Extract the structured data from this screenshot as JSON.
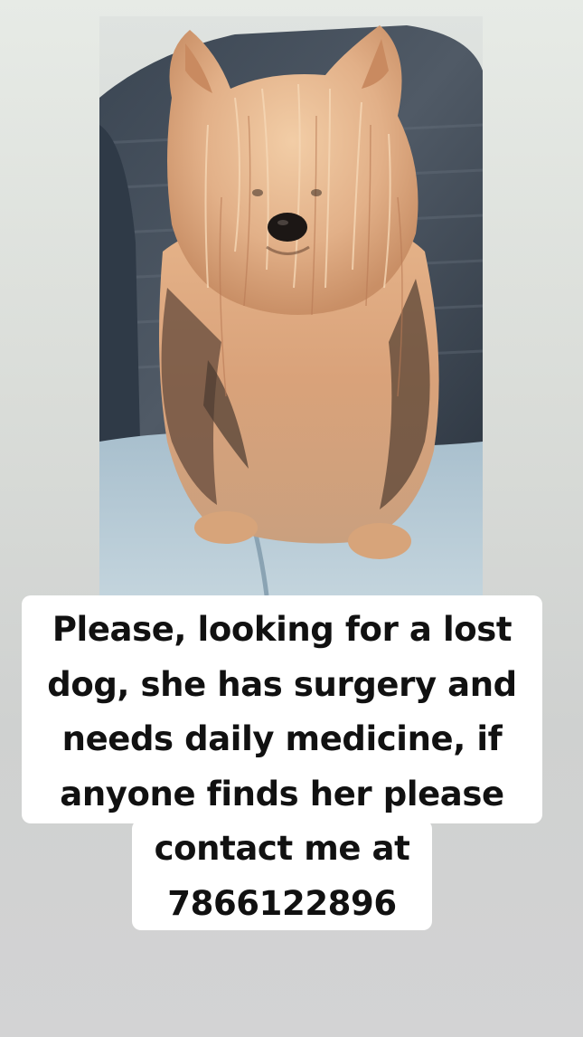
{
  "story": {
    "caption_lines": [
      "Please, looking for a lost",
      "dog, she has surgery and",
      "needs daily medicine, if",
      "anyone finds her please",
      "contact me at",
      "7866122896"
    ]
  },
  "colors": {
    "caption_background": "#ffffff",
    "caption_text": "#111111",
    "dog_fur_light": "#e8b98f",
    "dog_fur_dark": "#5a4436",
    "jeans": "#b9cdd8"
  },
  "icons": {
    "photo": "lost-dog-photo"
  }
}
